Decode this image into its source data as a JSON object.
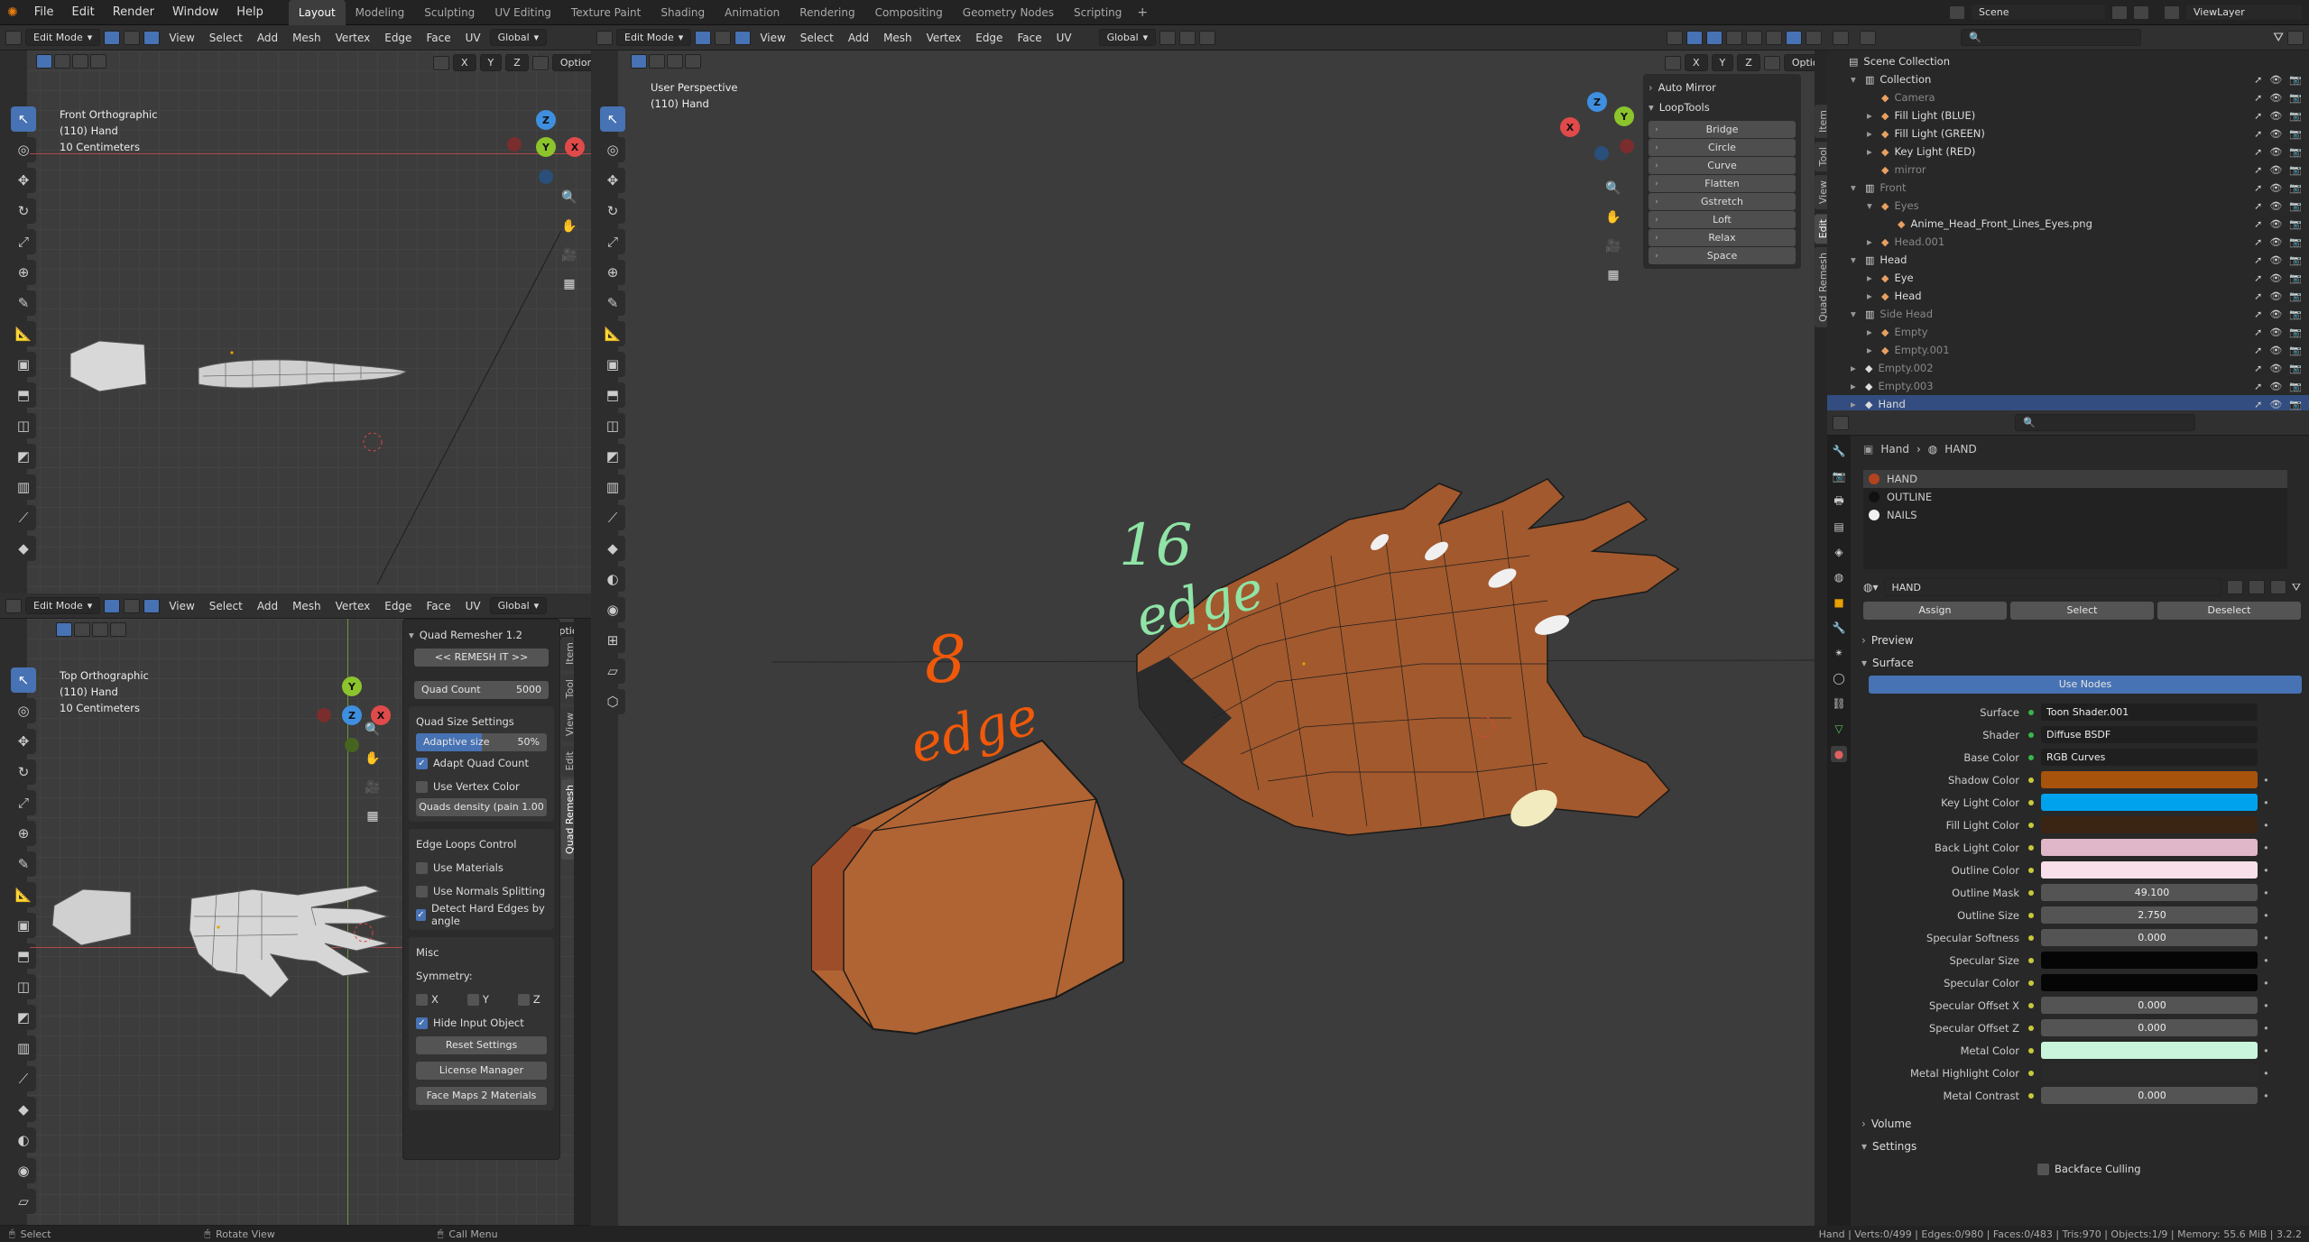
{
  "topbar": {
    "menu": [
      "File",
      "Edit",
      "Render",
      "Window",
      "Help"
    ],
    "workspaces": [
      "Layout",
      "Modeling",
      "Sculpting",
      "UV Editing",
      "Texture Paint",
      "Shading",
      "Animation",
      "Rendering",
      "Compositing",
      "Geometry Nodes",
      "Scripting"
    ],
    "add_tab": "+",
    "scene": "Scene",
    "viewlayer": "ViewLayer"
  },
  "vp_common": {
    "mode": "Edit Mode",
    "menus": [
      "View",
      "Select",
      "Add",
      "Mesh",
      "Vertex",
      "Edge",
      "Face",
      "UV"
    ],
    "orientation": "Global",
    "options": "Options",
    "axes": [
      "X",
      "Y",
      "Z"
    ]
  },
  "vp_front": {
    "view_name": "Front Orthographic",
    "object": "(110) Hand",
    "scale": "10 Centimeters"
  },
  "vp_top": {
    "view_name": "Top Orthographic",
    "object": "(110) Hand",
    "scale": "10 Centimeters"
  },
  "vp_main": {
    "view_name": "User Perspective",
    "object": "(110) Hand"
  },
  "gizmo": {
    "x": "X",
    "y": "Y",
    "z": "Z"
  },
  "annotations": {
    "left_num": "8",
    "left_word": "edge",
    "right_num": "16",
    "right_word": "edge"
  },
  "quad_remesher": {
    "title": "Quad Remesher 1.2",
    "remesh": "<< REMESH IT >>",
    "quad_count_label": "Quad Count",
    "quad_count_value": "5000",
    "size_settings": "Quad Size Settings",
    "adaptive_label": "Adaptive size",
    "adaptive_value": "50%",
    "adapt_quad_count": "Adapt Quad Count",
    "use_vertex_color": "Use Vertex Color",
    "quads_density": "Quads density (pain 1.00",
    "edge_loops": "Edge Loops Control",
    "use_materials": "Use Materials",
    "use_normals": "Use Normals Splitting",
    "detect_hard": "Detect Hard Edges by angle",
    "misc": "Misc",
    "symmetry": "Symmetry:",
    "sym_x": "X",
    "sym_y": "Y",
    "sym_z": "Z",
    "hide_input": "Hide Input Object",
    "reset": "Reset Settings",
    "license": "License Manager",
    "facemaps": "Face Maps 2 Materials"
  },
  "left_vtabs": [
    "Item",
    "Tool",
    "View",
    "Edit",
    "Quad Remesh"
  ],
  "main_vtabs": [
    "Item",
    "Tool",
    "View",
    "Edit",
    "Quad Remesh"
  ],
  "looptools": {
    "auto_mirror": "Auto Mirror",
    "title": "LoopTools",
    "buttons": [
      "Bridge",
      "Circle",
      "Curve",
      "Flatten",
      "Gstretch",
      "Loft",
      "Relax",
      "Space"
    ]
  },
  "outliner": {
    "rows": [
      {
        "label": "Scene Collection",
        "indent": 0,
        "dim": false,
        "sel": false,
        "arrow": ""
      },
      {
        "label": "Collection",
        "indent": 1,
        "dim": false,
        "sel": false,
        "arrow": "▾"
      },
      {
        "label": "Camera",
        "indent": 2,
        "dim": true,
        "sel": false,
        "arrow": ""
      },
      {
        "label": "Fill Light (BLUE)",
        "indent": 2,
        "dim": false,
        "sel": false,
        "arrow": "▸"
      },
      {
        "label": "Fill Light (GREEN)",
        "indent": 2,
        "dim": false,
        "sel": false,
        "arrow": "▸"
      },
      {
        "label": "Key Light (RED)",
        "indent": 2,
        "dim": false,
        "sel": false,
        "arrow": "▸"
      },
      {
        "label": "mirror",
        "indent": 2,
        "dim": true,
        "sel": false,
        "arrow": ""
      },
      {
        "label": "Front",
        "indent": 1,
        "dim": true,
        "sel": false,
        "arrow": "▾"
      },
      {
        "label": "Eyes",
        "indent": 2,
        "dim": true,
        "sel": false,
        "arrow": "▾"
      },
      {
        "label": "Anime_Head_Front_Lines_Eyes.png",
        "indent": 3,
        "dim": false,
        "sel": false,
        "arrow": ""
      },
      {
        "label": "Head.001",
        "indent": 2,
        "dim": true,
        "sel": false,
        "arrow": "▸"
      },
      {
        "label": "Head",
        "indent": 1,
        "dim": false,
        "sel": false,
        "arrow": "▾"
      },
      {
        "label": "Eye",
        "indent": 2,
        "dim": false,
        "sel": false,
        "arrow": "▸"
      },
      {
        "label": "Head",
        "indent": 2,
        "dim": false,
        "sel": false,
        "arrow": "▸"
      },
      {
        "label": "Side Head",
        "indent": 1,
        "dim": true,
        "sel": false,
        "arrow": "▾"
      },
      {
        "label": "Empty",
        "indent": 2,
        "dim": true,
        "sel": false,
        "arrow": "▸"
      },
      {
        "label": "Empty.001",
        "indent": 2,
        "dim": true,
        "sel": false,
        "arrow": "▸"
      },
      {
        "label": "Empty.002",
        "indent": 1,
        "dim": true,
        "sel": false,
        "arrow": "▸"
      },
      {
        "label": "Empty.003",
        "indent": 1,
        "dim": true,
        "sel": false,
        "arrow": "▸"
      },
      {
        "label": "Hand",
        "indent": 1,
        "dim": false,
        "sel": true,
        "arrow": "▸"
      }
    ]
  },
  "properties": {
    "breadcrumb_obj": "Hand",
    "breadcrumb_sep": "›",
    "breadcrumb_mat": "HAND",
    "slots": [
      "HAND",
      "OUTLINE",
      "NAILS"
    ],
    "slot_colors": [
      "#b3441f",
      "#111111",
      "#f0f0f0"
    ],
    "material": "HAND",
    "assign": "Assign",
    "select": "Select",
    "deselect": "Deselect",
    "preview": "Preview",
    "surface_section": "Surface",
    "use_nodes": "Use Nodes",
    "fields": [
      {
        "label": "Surface",
        "value": "Toon Shader.001",
        "kind": "text",
        "color": ""
      },
      {
        "label": "Shader",
        "value": "Diffuse BSDF",
        "kind": "text",
        "color": ""
      },
      {
        "label": "Base Color",
        "value": "RGB Curves",
        "kind": "text",
        "color": ""
      },
      {
        "label": "Shadow Color",
        "value": "",
        "kind": "color",
        "color": "#a8530c"
      },
      {
        "label": "Key Light Color",
        "value": "",
        "kind": "color",
        "color": "#00a2ee"
      },
      {
        "label": "Fill Light Color",
        "value": "",
        "kind": "color",
        "color": "#3a2414"
      },
      {
        "label": "Back Light Color",
        "value": "",
        "kind": "color",
        "color": "#e0b6c9"
      },
      {
        "label": "Outline Color",
        "value": "",
        "kind": "color",
        "color": "#f8dfe9"
      },
      {
        "label": "Outline Mask",
        "value": "49.100",
        "kind": "num",
        "color": ""
      },
      {
        "label": "Outline Size",
        "value": "2.750",
        "kind": "num",
        "color": ""
      },
      {
        "label": "Specular Softness",
        "value": "0.000",
        "kind": "num",
        "color": ""
      },
      {
        "label": "Specular Size",
        "value": "",
        "kind": "color",
        "color": "#050505"
      },
      {
        "label": "Specular Color",
        "value": "",
        "kind": "color",
        "color": "#050505"
      },
      {
        "label": "Specular Offset X",
        "value": "0.000",
        "kind": "num",
        "color": ""
      },
      {
        "label": "Specular Offset Z",
        "value": "0.000",
        "kind": "num",
        "color": ""
      },
      {
        "label": "Metal Color",
        "value": "",
        "kind": "color",
        "color": "#c8f5dc"
      },
      {
        "label": "Metal Highlight Color",
        "value": "",
        "kind": "color",
        "color": "#2a2a2a"
      },
      {
        "label": "Metal Contrast",
        "value": "0.000",
        "kind": "num",
        "color": ""
      }
    ],
    "volume": "Volume",
    "settings": "Settings",
    "backface": "Backface Culling"
  },
  "status": {
    "select": "Select",
    "rotate": "Rotate View",
    "call_menu": "Call Menu",
    "stats": "Hand | Verts:0/499 | Edges:0/980 | Faces:0/483 | Tris:970 | Objects:1/9 | Memory: 55.6 MiB | 3.2.2"
  }
}
